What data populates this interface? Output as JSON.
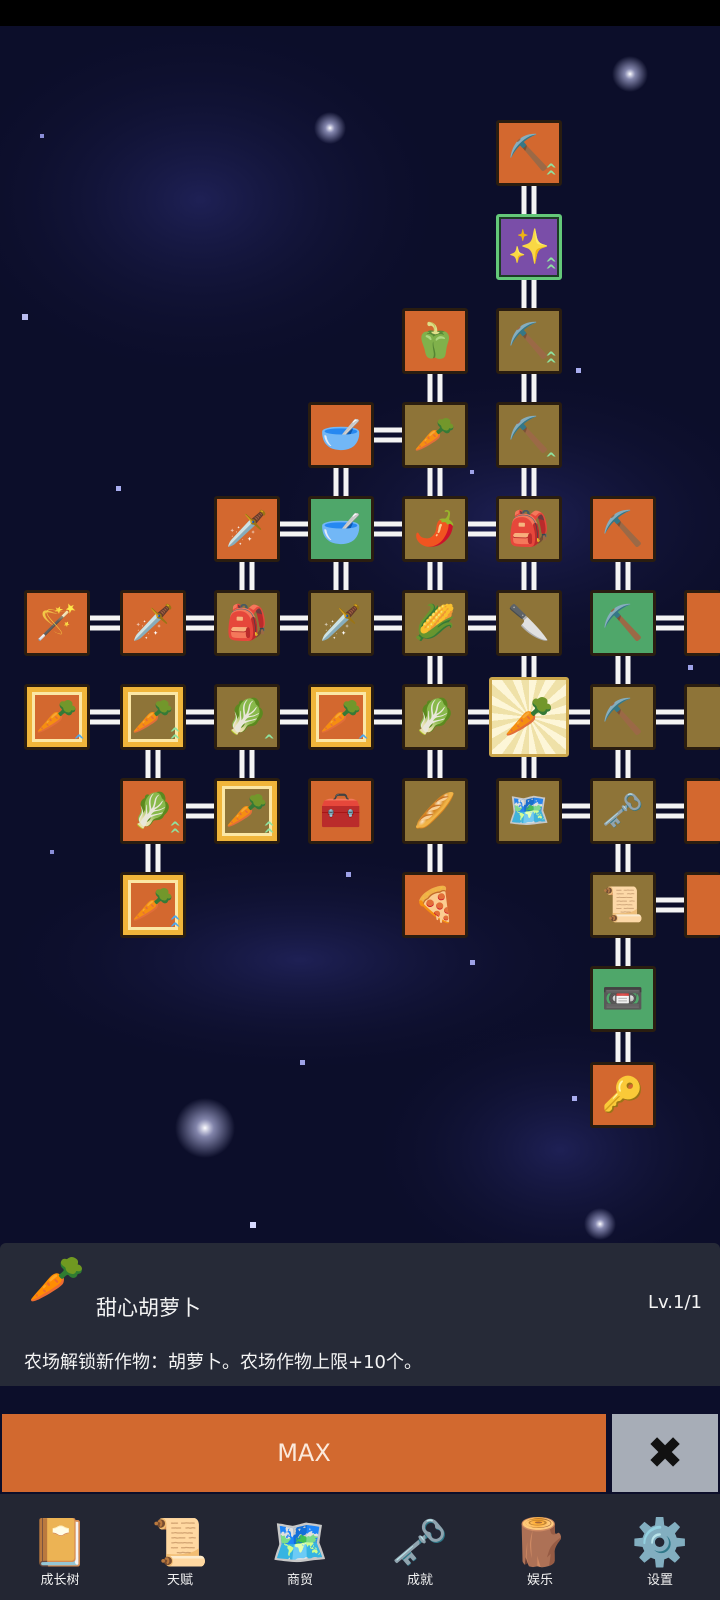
{
  "nodes": [
    {
      "id": "a1",
      "icon": "shovel-icon",
      "glyph": "⛏️",
      "bg": "orange",
      "boost": "g"
    },
    {
      "id": "a2",
      "icon": "magic-shovel-icon",
      "glyph": "✨",
      "bg": "violet",
      "boost": "g"
    },
    {
      "id": "a3",
      "icon": "shovel-icon",
      "glyph": "⛏️",
      "bg": "tan",
      "boost": "g"
    },
    {
      "id": "a4",
      "icon": "shovel-icon",
      "glyph": "⛏️",
      "bg": "tan",
      "boost": "g1"
    },
    {
      "id": "b1",
      "icon": "bell-pepper-icon",
      "glyph": "🫑",
      "bg": "orange"
    },
    {
      "id": "b2",
      "icon": "radish-icon",
      "glyph": "🥕",
      "bg": "tan"
    },
    {
      "id": "b3",
      "icon": "chili-pepper-icon",
      "glyph": "🌶️",
      "bg": "tan"
    },
    {
      "id": "b4",
      "icon": "corn-icon",
      "glyph": "🌽",
      "bg": "tan"
    },
    {
      "id": "c1",
      "icon": "bowl-icon",
      "glyph": "🥣",
      "bg": "orange"
    },
    {
      "id": "c2",
      "icon": "bowl-icon",
      "glyph": "🥣",
      "bg": "green"
    },
    {
      "id": "c3",
      "icon": "sword-icon",
      "glyph": "🗡️",
      "bg": "orange"
    },
    {
      "id": "d1",
      "icon": "backpack-icon",
      "glyph": "🎒",
      "bg": "tan"
    },
    {
      "id": "d2",
      "icon": "backpack-icon",
      "glyph": "🎒",
      "bg": "tan"
    },
    {
      "id": "d3",
      "icon": "sword-icon",
      "glyph": "🗡️",
      "bg": "tan"
    },
    {
      "id": "d4",
      "icon": "sword-icon",
      "glyph": "🗡️",
      "bg": "orange"
    },
    {
      "id": "d5",
      "icon": "magic-wand-icon",
      "glyph": "🪄",
      "bg": "orange"
    },
    {
      "id": "d6",
      "icon": "dagger-icon",
      "glyph": "🔪",
      "bg": "tan"
    },
    {
      "id": "e1",
      "icon": "pickaxe-icon",
      "glyph": "⛏️",
      "bg": "orange"
    },
    {
      "id": "e2",
      "icon": "pickaxe-icon",
      "glyph": "⛏️",
      "bg": "green"
    },
    {
      "id": "e3",
      "icon": "pickaxe-icon",
      "glyph": "⛏️",
      "bg": "tan"
    },
    {
      "id": "e4",
      "icon": "golden-key-icon",
      "glyph": "🗝️",
      "bg": "tan"
    },
    {
      "id": "e5",
      "icon": "scroll-icon",
      "glyph": "📜",
      "bg": "tan"
    },
    {
      "id": "e6",
      "icon": "cassette-icon",
      "glyph": "📼",
      "bg": "green"
    },
    {
      "id": "e7",
      "icon": "key-icon",
      "glyph": "🔑",
      "bg": "orange"
    },
    {
      "id": "f1",
      "icon": "carrot-icon",
      "glyph": "🥕",
      "bg": "orange",
      "framed": true,
      "boost": "b1"
    },
    {
      "id": "f2",
      "icon": "carrot-icon",
      "glyph": "🥕",
      "bg": "tan",
      "framed": true,
      "boost": "g"
    },
    {
      "id": "f3",
      "icon": "cabbage-icon",
      "glyph": "🥬",
      "bg": "tan",
      "boost": "g1"
    },
    {
      "id": "f4",
      "icon": "carrot-icon",
      "glyph": "🥕",
      "bg": "orange",
      "framed": true,
      "boost": "b1"
    },
    {
      "id": "f5",
      "icon": "cabbage-icon",
      "glyph": "🥬",
      "bg": "tan"
    },
    {
      "id": "f6",
      "icon": "sweet-carrot-icon",
      "glyph": "🥕",
      "bg": "selected"
    },
    {
      "id": "g1",
      "icon": "cabbage-icon",
      "glyph": "🥬",
      "bg": "orange",
      "boost": "g"
    },
    {
      "id": "g2",
      "icon": "carrot-icon",
      "glyph": "🥕",
      "bg": "tan",
      "framed": true,
      "boost": "g"
    },
    {
      "id": "g3",
      "icon": "treasure-chest-icon",
      "glyph": "🧰",
      "bg": "orange"
    },
    {
      "id": "g4",
      "icon": "parsnip-icon",
      "glyph": "🥖",
      "bg": "tan"
    },
    {
      "id": "g5",
      "icon": "map-icon",
      "glyph": "🗺️",
      "bg": "tan"
    },
    {
      "id": "g6",
      "icon": "pizza-icon",
      "glyph": "🍕",
      "bg": "orange"
    },
    {
      "id": "h1",
      "icon": "carrot-icon",
      "glyph": "🥕",
      "bg": "orange",
      "framed": true,
      "boost": "b"
    },
    {
      "id": "x1",
      "icon": "partial-node-icon",
      "glyph": "",
      "bg": "orange"
    },
    {
      "id": "x2",
      "icon": "partial-node-icon",
      "glyph": "",
      "bg": "tan"
    },
    {
      "id": "x3",
      "icon": "partial-node-icon",
      "glyph": "",
      "bg": "orange"
    },
    {
      "id": "x4",
      "icon": "partial-node-icon",
      "glyph": "",
      "bg": "orange"
    }
  ],
  "selected_skill": {
    "icon": "sweet-carrot-icon",
    "title": "甜心胡萝卜",
    "level": "Lv.1/1",
    "description": "农场解锁新作物：胡萝卜。农场作物上限+10个。"
  },
  "action_button": {
    "label": "MAX"
  },
  "close_button": {
    "icon": "close-x-icon"
  },
  "bottom_nav": [
    {
      "label": "成长树",
      "icon": "book-icon",
      "glyph": "📔"
    },
    {
      "label": "天赋",
      "icon": "scroll-icon",
      "glyph": "📜"
    },
    {
      "label": "商贸",
      "icon": "map-icon",
      "glyph": "🗺️"
    },
    {
      "label": "成就",
      "icon": "golden-key-icon",
      "glyph": "🗝️"
    },
    {
      "label": "娱乐",
      "icon": "wood-bridge-icon",
      "glyph": "🪵"
    },
    {
      "label": "设置",
      "icon": "gear-icon",
      "glyph": "⚙️"
    }
  ],
  "colors": {
    "orange": "#d3682f",
    "tan": "#8e7438",
    "green": "#4fa76a",
    "space": "#0c0e2a",
    "panel": "#262a37",
    "max_button": "#d2692f",
    "close_button": "#a7adb7"
  }
}
